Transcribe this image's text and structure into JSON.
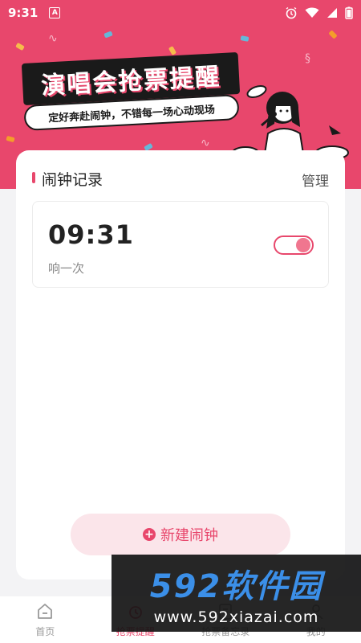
{
  "status_bar": {
    "time": "9:31",
    "a_badge": "A"
  },
  "header": {
    "title": "演唱会抢票提醒",
    "subtitle": "定好奔赴闹钟，不错每一场心动现场"
  },
  "alarms": {
    "section_title": "闹钟记录",
    "manage_label": "管理",
    "items": [
      {
        "time": "09:31",
        "repeat": "响一次",
        "enabled": true
      }
    ]
  },
  "new_alarm_label": "新建闹钟",
  "nav": {
    "items": [
      {
        "label": "首页",
        "icon": "home-icon",
        "active": false
      },
      {
        "label": "抢票提醒",
        "icon": "alarm-icon",
        "active": true
      },
      {
        "label": "抢票备忘录",
        "icon": "memo-icon",
        "active": false
      },
      {
        "label": "我的",
        "icon": "user-icon",
        "active": false
      }
    ]
  },
  "watermark": {
    "logo": "592软件园",
    "url": "www.592xiazai.com"
  },
  "colors": {
    "brand": "#e8476c",
    "brand_light": "#fbe5ea",
    "background": "#f3f3f5"
  }
}
